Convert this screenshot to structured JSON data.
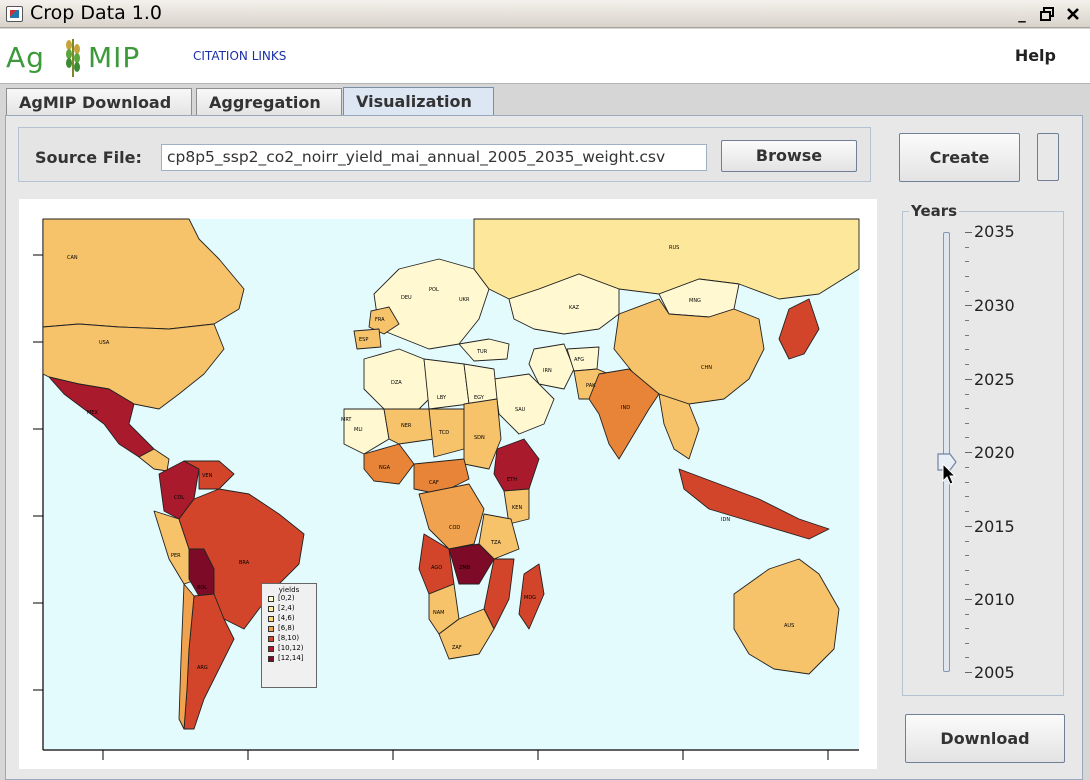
{
  "window": {
    "title": "Crop Data 1.0",
    "controls": {
      "minimize": "_",
      "restore": "🗗",
      "close": "✕"
    }
  },
  "header": {
    "logo_left": "Ag",
    "logo_right": "MIP",
    "citation_link": "CITATION LINKS",
    "help": "Help"
  },
  "tabs": [
    {
      "label": "AgMIP Download",
      "active": false
    },
    {
      "label": "Aggregation",
      "active": false
    },
    {
      "label": "Visualization",
      "active": true
    }
  ],
  "source": {
    "label": "Source File:",
    "value": "cp8p5_ssp2_co2_noirr_yield_mai_annual_2005_2035_weight.csv",
    "browse_label": "Browse"
  },
  "create_label": "Create",
  "download_label": "Download",
  "years": {
    "title": "Years",
    "ticks": [
      "2035",
      "2030",
      "2025",
      "2020",
      "2015",
      "2010",
      "2005"
    ],
    "min": 2005,
    "max": 2035,
    "selected": 2019
  },
  "map": {
    "legend_title": "yields",
    "legend": [
      {
        "label": "[0,2)",
        "color": "#ffffcc"
      },
      {
        "label": "[2,4)",
        "color": "#ffeda0"
      },
      {
        "label": "[4,6)",
        "color": "#fed976"
      },
      {
        "label": "[6,8)",
        "color": "#f0a24e"
      },
      {
        "label": "[8,10)",
        "color": "#d2452a"
      },
      {
        "label": "[10,12)",
        "color": "#b5142a"
      },
      {
        "label": "[12,14]",
        "color": "#7d0a26"
      }
    ],
    "ocean_color": "#e4fbfd",
    "country_labels": [
      "CAN",
      "USA",
      "MEX",
      "BRA",
      "ARG",
      "BOL",
      "COL",
      "VEN",
      "PER",
      "RUS",
      "KAZ",
      "MNG",
      "CHN",
      "IND",
      "AUS",
      "IDN",
      "ETH",
      "TZA",
      "COD",
      "AGO",
      "ZAF",
      "DZA",
      "LBY",
      "EGY",
      "SAU",
      "IRN",
      "AFG",
      "PAK",
      "TUR",
      "FRA",
      "ESP",
      "DEU",
      "POL",
      "UKR",
      "NGA",
      "NER",
      "TCD",
      "SDN",
      "MLI",
      "MDG",
      "ZMB",
      "KEN",
      "MRT",
      "CAF",
      "NAM"
    ]
  }
}
